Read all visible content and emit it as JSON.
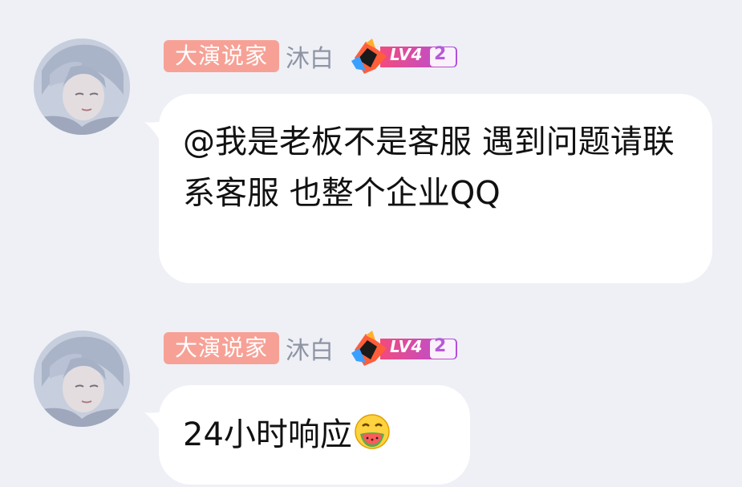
{
  "messages": [
    {
      "sender": {
        "title_badge": "大演说家",
        "nickname": "沐白",
        "level": "LV4",
        "rank": "2"
      },
      "text": "@我是老板不是客服  遇到问题请联系客服 也整个企业QQ"
    },
    {
      "sender": {
        "title_badge": "大演说家",
        "nickname": "沐白",
        "level": "LV4",
        "rank": "2"
      },
      "text": "24小时响应",
      "emoji": "watermelon-face-emoji"
    }
  ],
  "colors": {
    "background": "#eef0f6",
    "bubble": "#ffffff",
    "title_badge": "#f7a196",
    "nickname": "#8e94a3"
  }
}
